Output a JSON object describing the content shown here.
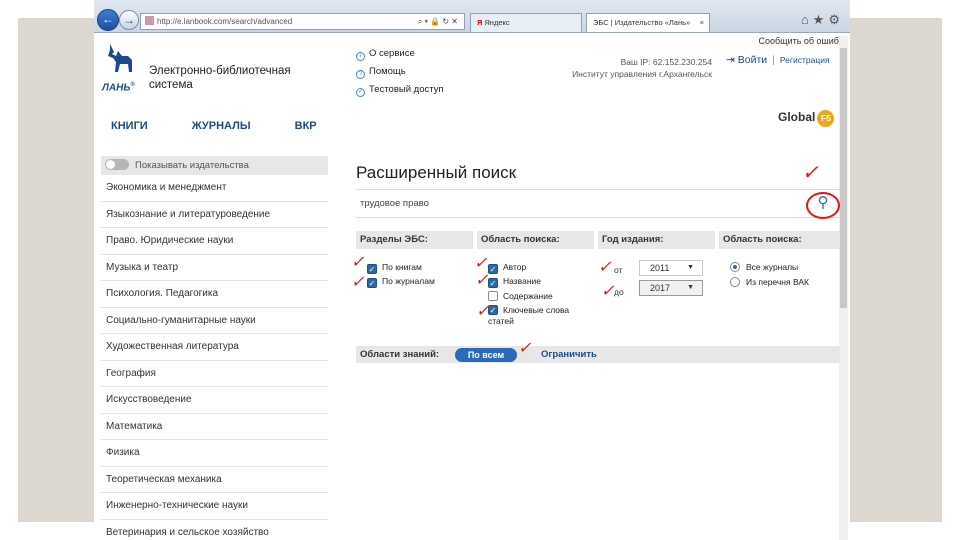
{
  "browser": {
    "address": "http://e.lanbook.com/search/advanced",
    "address_icons": "⌕ ▾ 🔒 ↻ ✕",
    "tabs": [
      {
        "label": "Яндекс",
        "prefix": "Я"
      },
      {
        "label": "ЭБС | Издательство «Лань»",
        "close": "×"
      }
    ],
    "icons": "⌂★⚙"
  },
  "header": {
    "report_error": "Сообщить об ошибке",
    "logo_text": "ЛАНЬ",
    "logo_mark": "®",
    "site_title": "Электронно-библиотечная система",
    "service_links": [
      "О сервисе",
      "Помощь",
      "Тестовый доступ"
    ],
    "ip_line": "Ваш IP: 62.152.230.254",
    "institution_line": "Институт управления г.Архангельск",
    "login": "Войти",
    "register": "Регистрация",
    "nav": [
      "КНИГИ",
      "ЖУРНАЛЫ",
      "ВКР"
    ],
    "global": "Global",
    "global_badge": "F5"
  },
  "sidebar": {
    "toggle_label": "Показывать издательства",
    "categories": [
      "Экономика и менеджмент",
      "Языкознание и литературоведение",
      "Право. Юридические науки",
      "Музыка и театр",
      "Психология. Педагогика",
      "Социально-гуманитарные науки",
      "Художественная литература",
      "География",
      "Искусствоведение",
      "Математика",
      "Физика",
      "Теоретическая механика",
      "Инженерно-технические науки",
      "Ветеринария и сельское хозяйство"
    ]
  },
  "search": {
    "title": "Расширенный поиск",
    "query": "трудовое право",
    "columns": {
      "sections": {
        "title": "Разделы ЭБС:",
        "options": [
          {
            "label": "По книгам",
            "checked": true
          },
          {
            "label": "По журналам",
            "checked": true
          }
        ]
      },
      "scope": {
        "title": "Область поиска:",
        "options": [
          {
            "label": "Автор",
            "checked": true
          },
          {
            "label": "Название",
            "checked": true
          },
          {
            "label": "Содержание",
            "checked": false
          },
          {
            "label": "Ключевые слова статей",
            "checked": true
          }
        ]
      },
      "year": {
        "title": "Год издания:",
        "from_label": "от",
        "from": "2011",
        "to_label": "до",
        "to": "2017"
      },
      "journal_scope": {
        "title": "Область поиска:",
        "options": [
          {
            "label": "Все журналы",
            "selected": true
          },
          {
            "label": "Из перечня ВАК",
            "selected": false
          }
        ]
      }
    },
    "knowledge_areas": "Области знаний:",
    "all_button": "По всем",
    "limit_link": "Ограничить"
  },
  "annotations": {
    "check_mark": "✓"
  }
}
